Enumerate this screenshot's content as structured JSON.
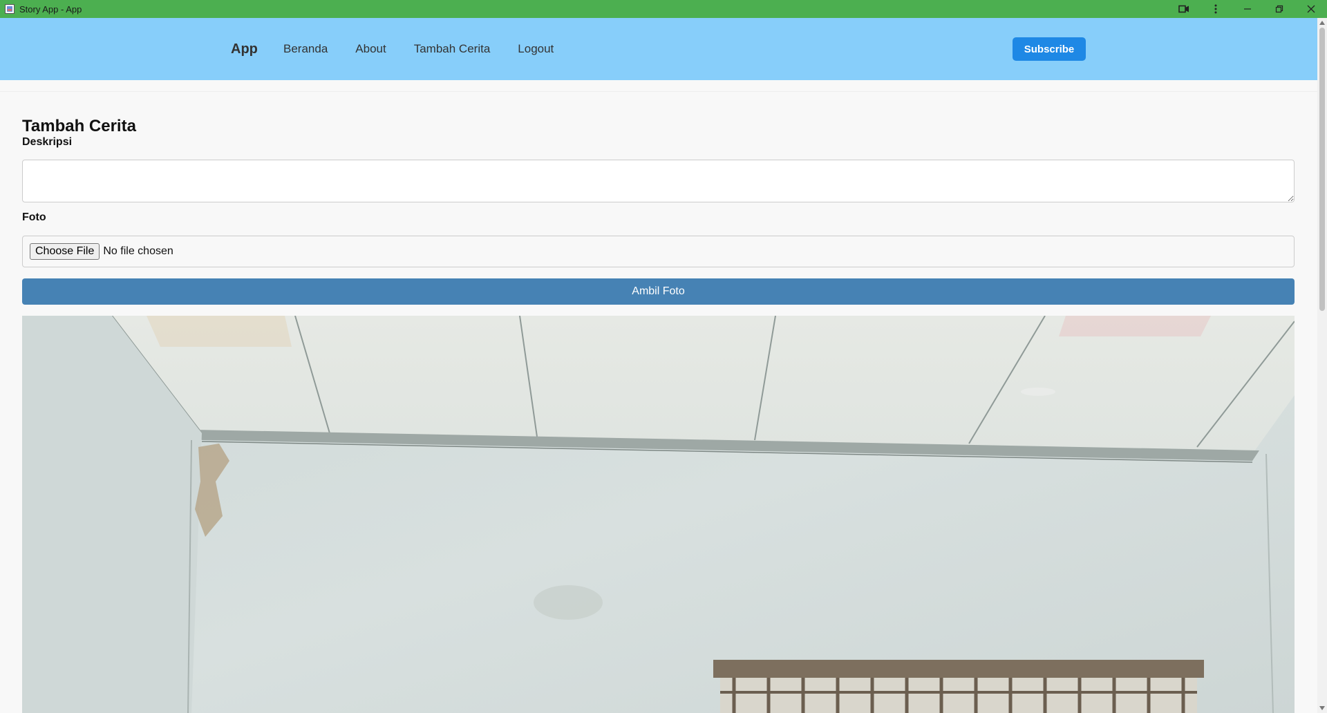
{
  "window": {
    "title": "Story App - App",
    "titlebar_color": "#4caf50"
  },
  "navbar": {
    "brand": "App",
    "links": [
      "Beranda",
      "About",
      "Tambah Cerita",
      "Logout"
    ],
    "subscribe_label": "Subscribe",
    "background_color": "#87cefa"
  },
  "form": {
    "title": "Tambah Cerita",
    "description_label": "Deskripsi",
    "description_value": "",
    "photo_label": "Foto",
    "choose_file_label": "Choose File",
    "file_status": "No file chosen",
    "capture_button_label": "Ambil Foto",
    "capture_button_color": "#4682b4"
  },
  "camera_preview": {
    "content": "live-camera-feed"
  },
  "icons": {
    "app": "story-app-icon",
    "cast": "video-camera-icon",
    "menu": "kebab-menu-icon",
    "minimize": "minimize-icon",
    "restore": "restore-icon",
    "close": "close-icon"
  }
}
